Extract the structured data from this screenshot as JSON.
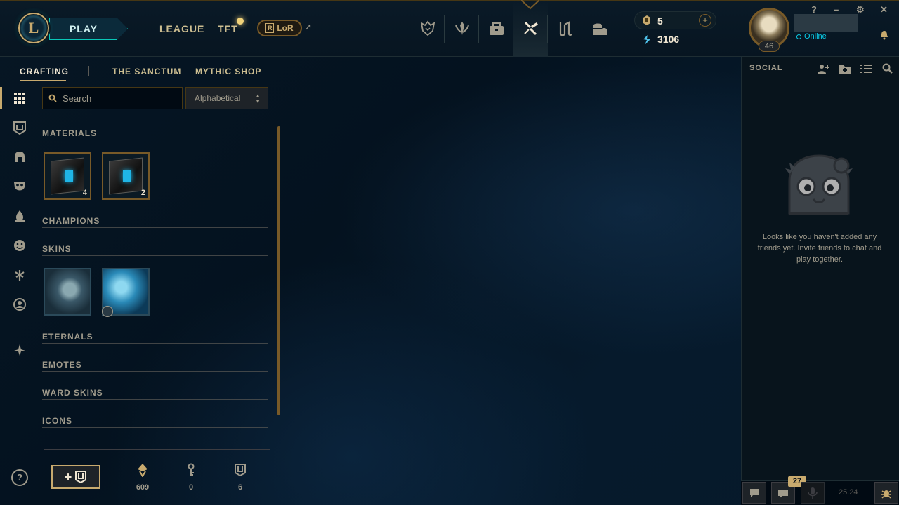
{
  "header": {
    "logo_letter": "L",
    "play_label": "PLAY",
    "nav_links": [
      "LEAGUE",
      "TFT"
    ],
    "lor_label": "LoR",
    "lor_glyph": "R",
    "external_arrow": "↗",
    "nav_icons": [
      "worlds-icon",
      "profile-crest-icon",
      "collection-icon",
      "loot-icon",
      "store-icon",
      "currency-stack-icon"
    ],
    "active_nav_icon": "loot-icon",
    "rp_value": "5",
    "plus_label": "+",
    "be_value": "3106",
    "level": "46",
    "status": "Online",
    "window_controls": [
      "?",
      "–",
      "⚙",
      "✕"
    ]
  },
  "left_rail": {
    "icons": [
      "grid-icon",
      "chest-icon",
      "helmet-icon",
      "mask-icon",
      "ward-icon",
      "emote-icon",
      "eternals-icon",
      "profile-icon-icon",
      "tft-icon"
    ]
  },
  "subnav": {
    "tabs": [
      "CRAFTING",
      "THE SANCTUM",
      "MYTHIC SHOP"
    ],
    "active": "CRAFTING"
  },
  "search": {
    "placeholder": "Search"
  },
  "sort": {
    "value": "Alphabetical"
  },
  "sections": {
    "materials": "MATERIALS",
    "champions": "CHAMPIONS",
    "skins": "SKINS",
    "eternals": "ETERNALS",
    "emotes": "EMOTES",
    "ward_skins": "WARD SKINS",
    "icons": "ICONS"
  },
  "materials": [
    {
      "name": "hextech-chest",
      "count": "4"
    },
    {
      "name": "masterwork-chest",
      "count": "2"
    }
  ],
  "bottom": {
    "help_label": "?",
    "add_key_label": "+",
    "resources": [
      {
        "icon": "orange-essence-icon",
        "value": "609"
      },
      {
        "icon": "key-fragment-icon",
        "value": "0"
      },
      {
        "icon": "key-icon",
        "value": "6"
      }
    ]
  },
  "social": {
    "title": "SOCIAL",
    "empty_message": "Looks like you haven't added any friends yet. Invite friends to chat and play together.",
    "chat_badge": "27",
    "version": "25.24"
  },
  "colors": {
    "gold": "#c8aa6e",
    "dark_gold": "#785a28",
    "text": "#a09b8c",
    "teal": "#0ac8b9",
    "online": "#0acbe6"
  }
}
